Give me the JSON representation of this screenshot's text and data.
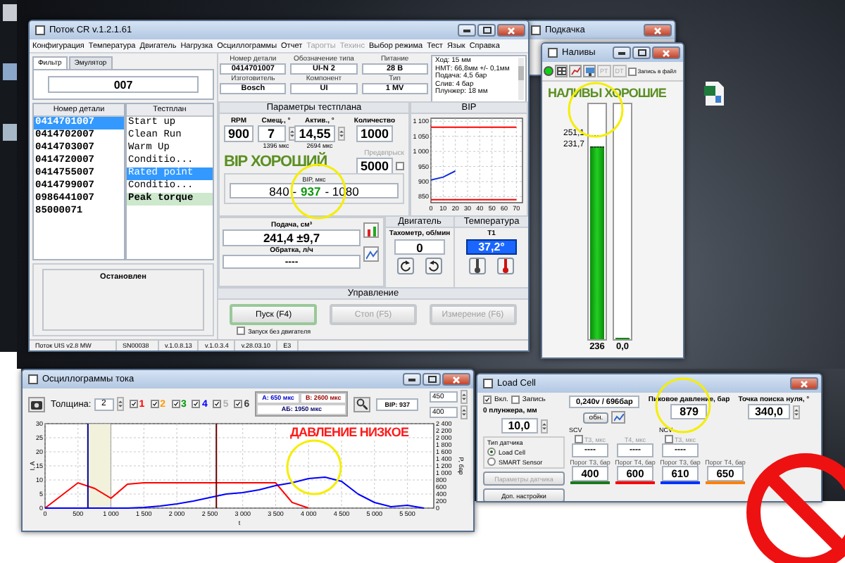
{
  "main_window": {
    "title": "Поток CR v.1.2.1.61",
    "menu": [
      {
        "label": "Конфигурация",
        "disabled": false
      },
      {
        "label": "Температура",
        "disabled": false
      },
      {
        "label": "Двигатель",
        "disabled": false
      },
      {
        "label": "Нагрузка",
        "disabled": false
      },
      {
        "label": "Осциллограммы",
        "disabled": false
      },
      {
        "label": "Отчет",
        "disabled": false
      },
      {
        "label": "Тарогты",
        "disabled": true
      },
      {
        "label": "Техинс",
        "disabled": true
      },
      {
        "label": "Выбор режима",
        "disabled": false
      },
      {
        "label": "Тест",
        "disabled": false
      },
      {
        "label": "Язык",
        "disabled": false
      },
      {
        "label": "Справка",
        "disabled": false
      }
    ],
    "filter_tabs": [
      {
        "label": "Фильтр",
        "selected": true
      },
      {
        "label": "Эмулятор",
        "selected": false
      }
    ],
    "filter": {
      "value": "007"
    },
    "parts": {
      "header": "Номер детали",
      "items": [
        {
          "label": "0414701007",
          "selected": true
        },
        {
          "label": "0414702007",
          "selected": false
        },
        {
          "label": "0414703007",
          "selected": false
        },
        {
          "label": "0414720007",
          "selected": false
        },
        {
          "label": "0414755007",
          "selected": false
        },
        {
          "label": "0414799007",
          "selected": false
        },
        {
          "label": "0986441007",
          "selected": false
        },
        {
          "label": "85000071",
          "selected": false
        }
      ]
    },
    "testplan": {
      "header": "Тестплан",
      "items": [
        {
          "label": "Start up",
          "selected": false,
          "marked": false
        },
        {
          "label": "Clean Run",
          "selected": false,
          "marked": false
        },
        {
          "label": "Warm Up",
          "selected": false,
          "marked": false
        },
        {
          "label": "Conditio...",
          "selected": false,
          "marked": false
        },
        {
          "label": "Rated point",
          "selected": true,
          "marked": false
        },
        {
          "label": "Conditio...",
          "selected": false,
          "marked": false
        },
        {
          "label": "Peak torque",
          "selected": false,
          "marked": true
        }
      ]
    },
    "status": "Остановлен",
    "info_fields": [
      {
        "label": "Номер детали",
        "value": "0414701007"
      },
      {
        "label": "Обозначение типа",
        "value": "UI-N 2"
      },
      {
        "label": "Питание",
        "value": "28 В"
      },
      {
        "label": "Изготовитель",
        "value": "Bosch"
      },
      {
        "label": "Компонент",
        "value": "UI"
      },
      {
        "label": "Тип",
        "value": "1 MV"
      }
    ],
    "info_text": [
      "Ход: 15 мм",
      "НМТ: 66,8мм +/- 0,1мм",
      "Подача: 4,5 бар",
      "Слив: 4 бар",
      "Плунжер: 18 мм"
    ],
    "params": {
      "title": "Параметры тестплана",
      "columns": [
        {
          "label": "RPM",
          "value": "900",
          "spinner": false
        },
        {
          "label": "Смещ., °",
          "value": "7",
          "spinner": true,
          "note": "1396 мкс"
        },
        {
          "label": "Актив., °",
          "value": "14,55",
          "spinner": true,
          "note": "2694 мкс"
        },
        {
          "label": "Количество",
          "value": "1000",
          "spinner": false
        }
      ],
      "preinjection": {
        "label": "Предвпрыск",
        "value": "5000",
        "checked": false
      }
    },
    "annotation": "ВІР ХОРОШИЙ",
    "bip": {
      "label": "BIP, мкс",
      "low": "840 -",
      "value": "937",
      "high": "- 1080"
    },
    "bip_chart": {
      "chart_data": {
        "type": "line",
        "title": "BIP",
        "grid": true,
        "x": [
          0,
          10,
          20,
          30,
          40,
          50,
          60,
          70
        ],
        "xlim": [
          0,
          75
        ],
        "ylim": [
          830,
          1110
        ],
        "xticks": [
          0,
          10,
          20,
          30,
          40,
          50,
          60,
          70
        ],
        "yticks": [
          {
            "value": 1100,
            "label": "1 100"
          },
          {
            "value": 1050,
            "label": "1 050"
          },
          {
            "value": 1000,
            "label": "1 000"
          },
          {
            "value": 950,
            "label": "950"
          },
          {
            "value": 900,
            "label": "900"
          },
          {
            "value": 850,
            "label": "850"
          }
        ],
        "series": [
          {
            "color": "#ff0000",
            "values": [
              1080,
              1080,
              1080,
              1080,
              1080,
              1080,
              1080,
              1080
            ]
          },
          {
            "color": "#ff0000",
            "values": [
              840,
              840,
              840,
              840,
              840,
              840,
              840,
              840
            ]
          },
          {
            "color": "#1030e0",
            "values": [
              905,
              915,
              935,
              null,
              null,
              null,
              null,
              null
            ]
          }
        ]
      }
    },
    "delivery": {
      "label": "Подача, см³",
      "value": "241,4 ±9,7"
    },
    "return_flow": {
      "label": "Обратка, л/ч",
      "value": "----"
    },
    "engine": {
      "title": "Двигатель",
      "label": "Тахометр, об/мин",
      "value": "0"
    },
    "temperature": {
      "title": "Температура",
      "label": "T1",
      "value": "37,2°"
    },
    "control": {
      "title": "Управление",
      "buttons": [
        {
          "label": "Пуск (F4)",
          "disabled": false
        },
        {
          "label": "Стоп (F5)",
          "disabled": true
        },
        {
          "label": "Измерение (F6)",
          "disabled": true
        }
      ],
      "no_engine": {
        "label": "Запуск без двигателя",
        "checked": false
      }
    },
    "status_bar": [
      "Поток UIS v2.8 MW",
      "SN00038",
      "v.1.0.8.13",
      "v.1.0.3.4",
      "v.28.03.10",
      "E3"
    ]
  },
  "pump_window": {
    "title": "Подкачка"
  },
  "fills_window": {
    "title": "Наливы",
    "indicator_on": true,
    "toolbar_buttons": [
      {
        "label": "PT",
        "disabled": true
      },
      {
        "label": "DT",
        "disabled": true
      }
    ],
    "record": {
      "label": "Запись в файл",
      "checked": false
    },
    "annotation": "НАЛИВЫ ХОРОШИЕ",
    "markers": [
      {
        "label": "251,1",
        "level": 0.87
      },
      {
        "label": "231,7",
        "level": 0.82
      }
    ],
    "bars": [
      {
        "level": 0.82,
        "reading": "236"
      },
      {
        "level": 0,
        "reading": "0,0"
      }
    ]
  },
  "osc_window": {
    "title": "Осциллограммы тока",
    "thickness": {
      "label": "Толщина:",
      "value": "2"
    },
    "channels": [
      {
        "label": "1",
        "checked": true,
        "color": "#ff0000"
      },
      {
        "label": "2",
        "checked": true,
        "color": "#ff9900"
      },
      {
        "label": "3",
        "checked": true,
        "color": "#009900"
      },
      {
        "label": "4",
        "checked": true,
        "color": "#0000ff"
      },
      {
        "label": "5",
        "checked": true,
        "color": "#b0b0b0"
      },
      {
        "label": "6",
        "checked": true,
        "color": "#404040"
      }
    ],
    "cursors": [
      {
        "text": "А: 650 мкс",
        "color": "#0000cc"
      },
      {
        "text": "В: 2600 мкс",
        "color": "#990000"
      },
      {
        "text": "АБ: 1950 мкс",
        "color": "#000066"
      }
    ],
    "bip": "BIP: 937",
    "range": [
      "450",
      "400"
    ],
    "annotation": "ДАВЛЕНИЕ НИЗКОЕ",
    "chart_data": {
      "type": "line",
      "grid": true,
      "xlabel": "t",
      "ylabel": "I, A",
      "y2label": "P, бар",
      "x": [
        0,
        250,
        500,
        750,
        1000,
        1250,
        1500,
        1750,
        2000,
        2250,
        2500,
        2750,
        3000,
        3250,
        3500,
        3750,
        4000,
        4250,
        4500,
        4750,
        5000,
        5250,
        5500,
        5750
      ],
      "xlim": [
        0,
        5900
      ],
      "ylim": [
        0,
        30
      ],
      "y2lim": [
        0,
        2400
      ],
      "xticks": [
        {
          "value": 0,
          "label": "0"
        },
        {
          "value": 500,
          "label": "500"
        },
        {
          "value": 1000,
          "label": "1 000"
        },
        {
          "value": 1500,
          "label": "1 500"
        },
        {
          "value": 2000,
          "label": "2 000"
        },
        {
          "value": 2500,
          "label": "2 500"
        },
        {
          "value": 3000,
          "label": "3 000"
        },
        {
          "value": 3500,
          "label": "3 500"
        },
        {
          "value": 4000,
          "label": "4 000"
        },
        {
          "value": 4500,
          "label": "4 500"
        },
        {
          "value": 5000,
          "label": "5 000"
        },
        {
          "value": 5500,
          "label": "5 500"
        }
      ],
      "yticks": [
        0,
        5,
        10,
        15,
        20,
        25,
        30
      ],
      "y2ticks": [
        {
          "value": 0,
          "label": "0"
        },
        {
          "value": 200,
          "label": "200"
        },
        {
          "value": 400,
          "label": "400"
        },
        {
          "value": 600,
          "label": "600"
        },
        {
          "value": 800,
          "label": "800"
        },
        {
          "value": 1000,
          "label": "1 000"
        },
        {
          "value": 1200,
          "label": "1 200"
        },
        {
          "value": 1400,
          "label": "1 400"
        },
        {
          "value": 1600,
          "label": "1 600"
        },
        {
          "value": 1800,
          "label": "1 800"
        },
        {
          "value": 2000,
          "label": "2 000"
        },
        {
          "value": 2200,
          "label": "2 200"
        },
        {
          "value": 2400,
          "label": "2 400"
        }
      ],
      "series": [
        {
          "color": "#ff0000",
          "values": [
            0,
            4.5,
            9,
            7,
            3.5,
            8.5,
            9,
            9,
            9,
            9,
            9,
            9,
            9,
            9,
            9,
            2,
            0,
            null,
            null,
            null,
            null,
            null,
            null,
            null
          ]
        },
        {
          "color": "#0000ff",
          "axis": "y2",
          "values": [
            0,
            0,
            0,
            0,
            0,
            0,
            20,
            60,
            120,
            200,
            300,
            400,
            440,
            520,
            640,
            720,
            840,
            880,
            760,
            400,
            160,
            40,
            80,
            0
          ]
        }
      ],
      "bands": [
        {
          "axis": "x",
          "from": 650,
          "to": 1000
        }
      ],
      "ref_lines": [
        {
          "axis": "x",
          "value": 650,
          "color": "#000099"
        },
        {
          "axis": "x",
          "value": 2600,
          "color": "#660000"
        }
      ]
    }
  },
  "loadcell_window": {
    "title": "Load Cell",
    "enable": {
      "label": "Вкл.",
      "checked": true
    },
    "record": {
      "label": "Запись",
      "checked": false
    },
    "sensor_reading": "0,240v / 696бар",
    "update_button": "обн.",
    "plunger": {
      "label": "0 плунжера, мм",
      "value": "10,0"
    },
    "peak": {
      "label": "Пиковое давление, бар",
      "value": "879"
    },
    "zero_point": {
      "label": "Точка поиска нуля, °",
      "value": "340,0"
    },
    "sensor_type": {
      "label": "Тип датчика",
      "options": [
        {
          "label": "Load Cell",
          "selected": true
        },
        {
          "label": "SMART Sensor",
          "selected": false
        }
      ]
    },
    "buttons": [
      {
        "label": "Параметры датчика",
        "disabled": true
      },
      {
        "label": "Доп. настройки",
        "disabled": false
      }
    ],
    "groups": [
      {
        "label": "SCV",
        "timers": [
          {
            "label": "T3, мкс",
            "value": "----",
            "kind": "check",
            "checked": false
          },
          {
            "label": "T4, мкс",
            "value": "----",
            "kind": "plain"
          }
        ]
      },
      {
        "label": "NCV",
        "timers": [
          {
            "label": "T3, мкс",
            "value": "----",
            "kind": "check",
            "checked": false
          }
        ]
      }
    ],
    "thresholds": [
      {
        "label": "Порог T3, бар",
        "value": "400",
        "color": "#1a7a1a"
      },
      {
        "label": "Порог T4, бар",
        "value": "600",
        "color": "#ff0000"
      },
      {
        "label": "Порог T3, бар",
        "value": "610",
        "color": "#0033ff"
      },
      {
        "label": "Порог T4, бар",
        "value": "650",
        "color": "#ff8000"
      }
    ]
  }
}
